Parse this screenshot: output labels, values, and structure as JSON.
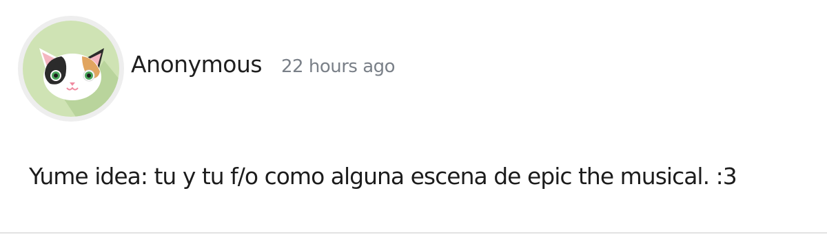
{
  "post": {
    "author": "Anonymous",
    "timestamp": "22 hours ago",
    "message": "Yume idea: tu y tu f/o como alguna escena de epic the musical. :3",
    "avatar_icon": "calico-cat-icon"
  },
  "colors": {
    "avatar_background": "#cfe3b4",
    "avatar_ring": "#eeeeee",
    "timestamp_text": "#7a8088",
    "divider": "#e2e2e2"
  }
}
